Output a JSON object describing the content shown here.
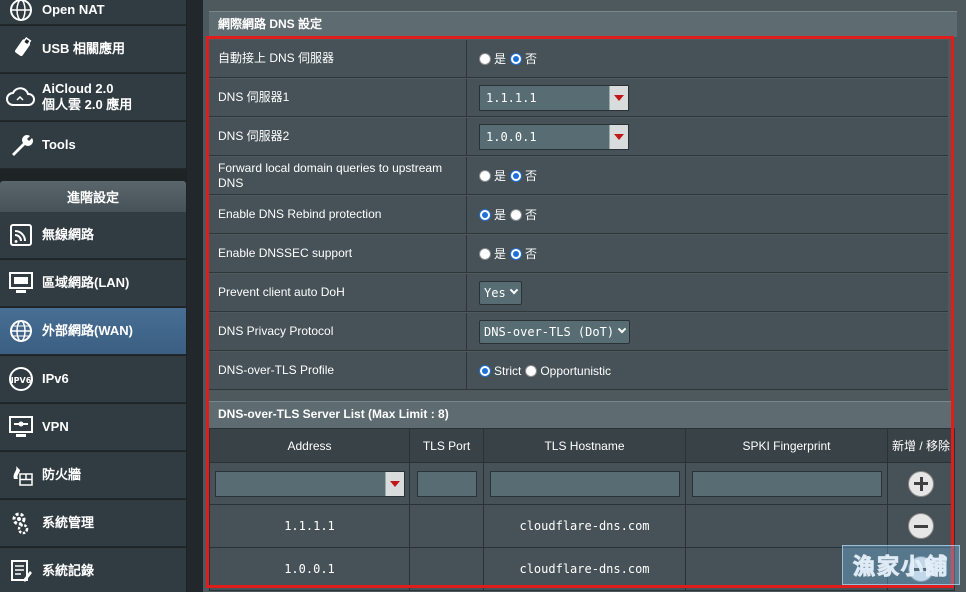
{
  "sidebar": {
    "top_items": [
      {
        "label": "Open NAT",
        "icon": "globe-icon"
      },
      {
        "label": "USB 相關應用",
        "icon": "usb-icon"
      },
      {
        "label": "AiCloud 2.0",
        "label2": "個人雲 2.0 應用",
        "icon": "cloud-icon"
      },
      {
        "label": "Tools",
        "icon": "wrench-icon"
      }
    ],
    "advanced_header": "進階設定",
    "advanced_items": [
      {
        "label": "無線網路",
        "icon": "wireless-icon",
        "active": false
      },
      {
        "label": "區域網路(LAN)",
        "icon": "lan-icon",
        "active": false
      },
      {
        "label": "外部網路(WAN)",
        "icon": "wan-globe-icon",
        "active": true
      },
      {
        "label": "IPv6",
        "icon": "ipv6-icon",
        "active": false
      },
      {
        "label": "VPN",
        "icon": "vpn-icon",
        "active": false
      },
      {
        "label": "防火牆",
        "icon": "firewall-icon",
        "active": false
      },
      {
        "label": "系統管理",
        "icon": "admin-gear-icon",
        "active": false
      },
      {
        "label": "系統記錄",
        "icon": "log-icon",
        "active": false
      }
    ]
  },
  "main": {
    "section_title": "網際網路 DNS 設定",
    "auto_dns": {
      "label": "自動接上 DNS 伺服器",
      "options": [
        "是",
        "否"
      ],
      "selected": "否"
    },
    "dns1": {
      "label": "DNS 伺服器1",
      "value": "1.1.1.1"
    },
    "dns2": {
      "label": "DNS 伺服器2",
      "value": "1.0.0.1"
    },
    "forward_local": {
      "label": "Forward local domain queries to upstream DNS",
      "options": [
        "是",
        "否"
      ],
      "selected": "否"
    },
    "rebind": {
      "label": "Enable DNS Rebind protection",
      "options": [
        "是",
        "否"
      ],
      "selected": "是"
    },
    "dnssec": {
      "label": "Enable DNSSEC support",
      "options": [
        "是",
        "否"
      ],
      "selected": "否"
    },
    "prevent_doh": {
      "label": "Prevent client auto DoH",
      "value": "Yes"
    },
    "privacy_protocol": {
      "label": "DNS Privacy Protocol",
      "value": "DNS-over-TLS (DoT)"
    },
    "dot_profile": {
      "label": "DNS-over-TLS Profile",
      "options": [
        "Strict",
        "Opportunistic"
      ],
      "selected": "Strict"
    }
  },
  "server_list": {
    "title": "DNS-over-TLS Server List (Max Limit : 8)",
    "headers": [
      "Address",
      "TLS Port",
      "TLS Hostname",
      "SPKI Fingerprint",
      "新增 / 移除"
    ],
    "rows": [
      {
        "address": "1.1.1.1",
        "port": "",
        "hostname": "cloudflare-dns.com",
        "spki": ""
      },
      {
        "address": "1.0.0.1",
        "port": "",
        "hostname": "cloudflare-dns.com",
        "spki": ""
      }
    ]
  },
  "watermark": "漁家小舖",
  "colors": {
    "highlight_frame": "#e01d1d",
    "active_nav": "#42668a",
    "radio_selected": "#1e6fd9"
  }
}
